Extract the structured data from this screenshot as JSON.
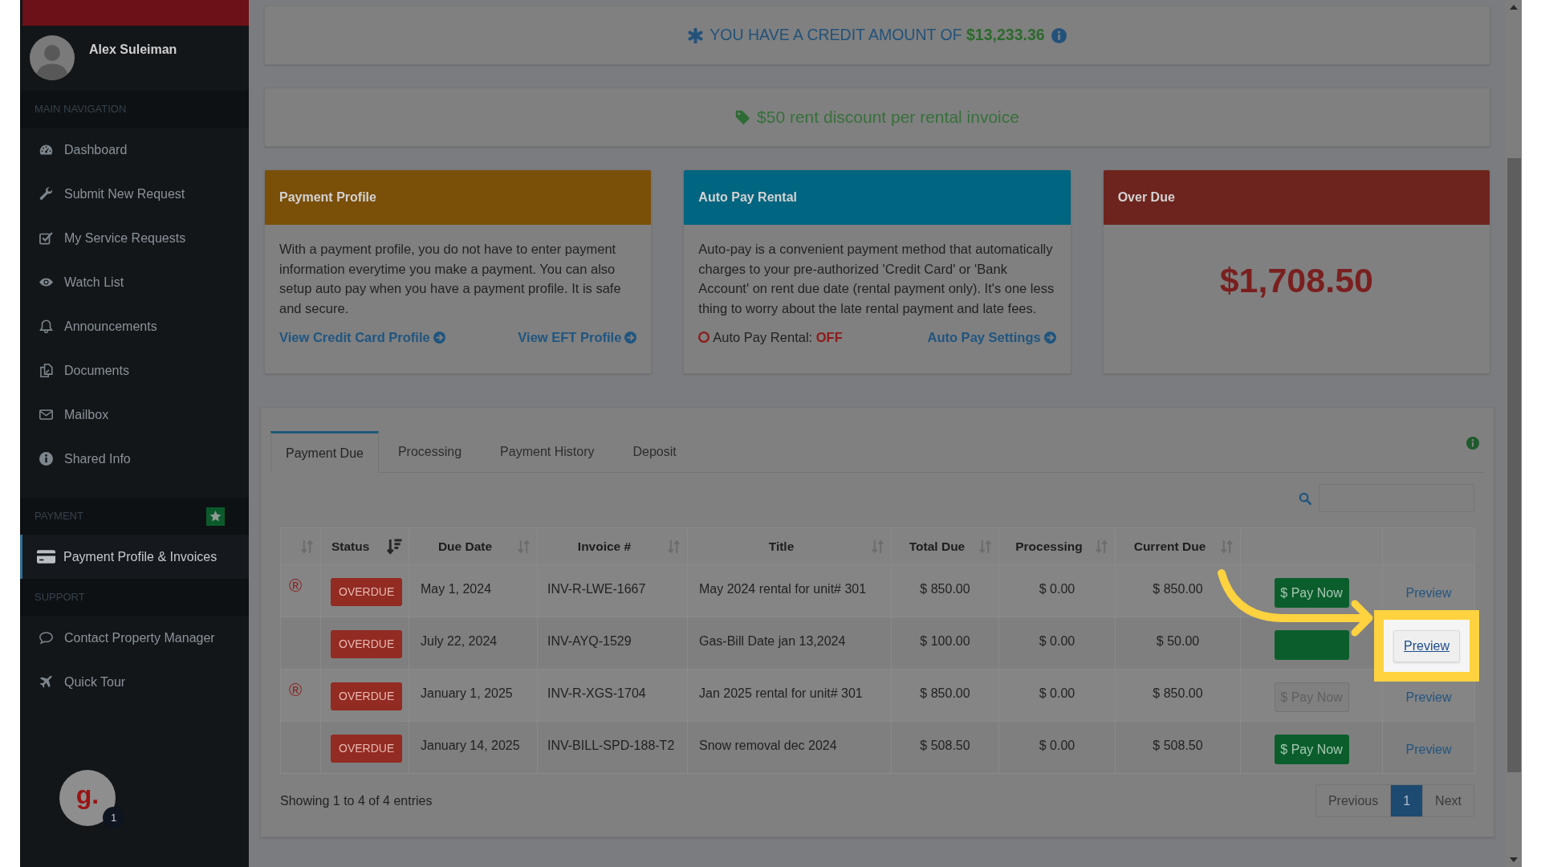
{
  "sidebar": {
    "user": {
      "name": "Alex Suleiman"
    },
    "sections": [
      {
        "header": "MAIN NAVIGATION",
        "starred": false,
        "items": [
          {
            "label": "Dashboard",
            "selected": false
          },
          {
            "label": "Submit New Request",
            "selected": false
          },
          {
            "label": "My Service Requests",
            "selected": false
          },
          {
            "label": "Watch List",
            "selected": false
          },
          {
            "label": "Announcements",
            "selected": false
          },
          {
            "label": "Documents",
            "selected": false
          },
          {
            "label": "Mailbox",
            "selected": false
          },
          {
            "label": "Shared Info",
            "selected": false
          }
        ]
      },
      {
        "header": "PAYMENT",
        "starred": true,
        "items": [
          {
            "label": "Payment Profile & Invoices",
            "selected": true
          }
        ]
      },
      {
        "header": "SUPPORT",
        "starred": false,
        "items": [
          {
            "label": "Contact Property Manager",
            "selected": false
          },
          {
            "label": "Quick Tour",
            "selected": false
          }
        ]
      }
    ],
    "launcher": {
      "logo": "g.",
      "badge": "1"
    }
  },
  "credit_banner": {
    "text": "YOU HAVE A CREDIT AMOUNT OF **$13,233.36**"
  },
  "discount_banner": {
    "text": "$50 rent discount per rental invoice"
  },
  "cards": [
    {
      "kind": "profile",
      "title": "Payment Profile",
      "color": "#7a4f08",
      "body": "With a payment profile, you do not have to enter payment information everytime you make a payment. You can also setup auto pay when you have a payment profile. It is safe and secure.",
      "links": [
        "View Credit Card Profile",
        "View EFT Profile"
      ]
    },
    {
      "kind": "autopay",
      "title": "Auto Pay Rental",
      "color": "#006580",
      "body": "Auto-pay is a convenient payment method that automatically charges to your pre-authorized 'Credit Card' or 'Bank Account' on rent due date (rental payment only). It's one less thing to worry about the late rental payment and late fees.",
      "status": "Auto Pay Rental: **OFF**",
      "on": false,
      "links": [
        "Auto Pay Settings"
      ]
    },
    {
      "kind": "amount",
      "title": "Over Due",
      "color": "#6e241e",
      "amount": "$1,708.50"
    }
  ],
  "tabs": [
    {
      "label": "Payment Due",
      "selected": true
    },
    {
      "label": "Processing",
      "selected": false
    },
    {
      "label": "Payment History",
      "selected": false
    },
    {
      "label": "Deposit",
      "selected": false
    }
  ],
  "table": {
    "columns": [
      {
        "sorted": false
      },
      {
        "label": "Status",
        "sorted": true
      },
      {
        "label": "Due Date",
        "sorted": false
      },
      {
        "label": "Invoice #",
        "sorted": false
      },
      {
        "label": "Title",
        "sorted": false
      },
      {
        "label": "Total Due",
        "sorted": false
      },
      {
        "label": "Processing",
        "sorted": false
      },
      {
        "label": "Current Due",
        "sorted": false
      }
    ],
    "rows": [
      {
        "mark": "®",
        "status": "OVERDUE",
        "due_date": "May 1, 2024",
        "invoice": "INV-R-LWE-1667",
        "title": "May 2024 rental for unit# 301",
        "total_due": "$ 850.00",
        "processing": "$ 0.00",
        "current_due": "$ 850.00",
        "pay": {
          "label": "$ Pay Now",
          "disabled": false
        },
        "preview": {
          "label": "Preview",
          "highlighted": false
        }
      },
      {
        "status": "OVERDUE",
        "due_date": "July 22, 2024",
        "invoice": "INV-AYQ-1529",
        "title": "Gas-Bill Date jan 13,2024",
        "total_due": "$ 100.00",
        "processing": "$ 0.00",
        "current_due": "$ 50.00",
        "pay": {
          "disabled": false
        },
        "preview": {
          "label": "Preview",
          "highlighted": true
        }
      },
      {
        "mark": "®",
        "status": "OVERDUE",
        "due_date": "January 1, 2025",
        "invoice": "INV-R-XGS-1704",
        "title": "Jan 2025 rental for unit# 301",
        "total_due": "$ 850.00",
        "processing": "$ 0.00",
        "current_due": "$ 850.00",
        "pay": {
          "label": "$ Pay Now",
          "disabled": true
        },
        "preview": {
          "label": "Preview",
          "highlighted": false
        }
      },
      {
        "status": "OVERDUE",
        "due_date": "January 14, 2025",
        "invoice": "INV-BILL-SPD-188-T2",
        "title": "Snow removal dec 2024",
        "total_due": "$ 508.50",
        "processing": "$ 0.00",
        "current_due": "$ 508.50",
        "pay": {
          "label": "$ Pay Now",
          "disabled": false
        },
        "preview": {
          "label": "Preview",
          "highlighted": false
        }
      }
    ]
  },
  "footer": {
    "info": "Showing 1 to 4 of 4 entries",
    "pagination": [
      {
        "label": "Previous",
        "selected": false
      },
      {
        "label": "1",
        "selected": true
      },
      {
        "label": "Next",
        "selected": false
      }
    ]
  }
}
